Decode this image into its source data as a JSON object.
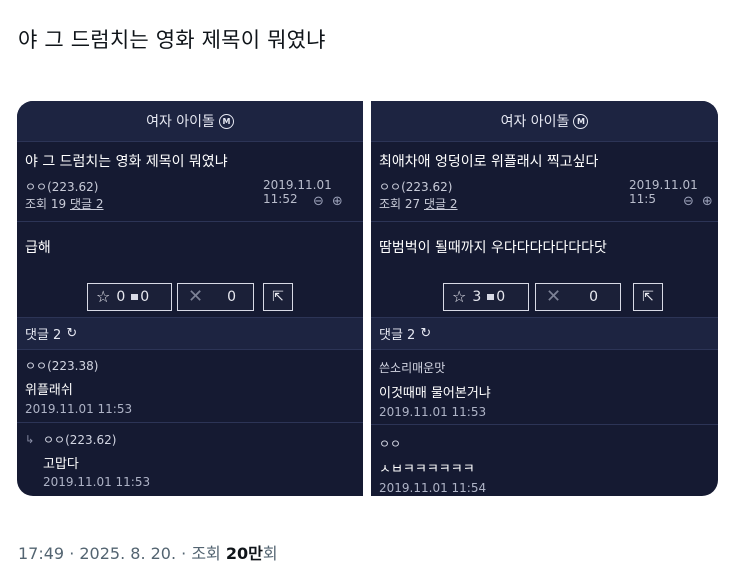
{
  "tweet": {
    "text": "야 그 드럼치는 영화 제목이 뭐였냐"
  },
  "left": {
    "header": "여자 아이돌",
    "header_badge": "M",
    "title": "야 그 드럼치는 영화 제목이 뭐였냐",
    "author": "ㅇㅇ(223.62)",
    "date": "2019.11.01 11:52",
    "views_label": "조회 19",
    "comments_link": "댓글 2",
    "body": "급해",
    "up_count": "0",
    "up_mini": "0",
    "down_count": "0",
    "comment_bar": "댓글 2",
    "comments": [
      {
        "author": "ㅇㅇ(223.38)",
        "text": "위플래쉬",
        "date": "2019.11.01 11:53"
      },
      {
        "author": "ㅇㅇ(223.62)",
        "text": "고맙다",
        "date": "2019.11.01 11:53"
      }
    ]
  },
  "right": {
    "header": "여자 아이돌",
    "header_badge": "M",
    "title": "최애차애 엉덩이로 위플래시 찍고싶다",
    "author": "ㅇㅇ(223.62)",
    "date": "2019.11.01 11:5",
    "views_label": "조회 27",
    "comments_link": "댓글 2",
    "body": "땀범벅이 될때까지 우다다다다다다다닷",
    "up_count": "3",
    "up_mini": "0",
    "down_count": "0",
    "comment_bar": "댓글 2",
    "comments": [
      {
        "author": "쓴소리매운맛",
        "text": "이것때매 물어본거냐",
        "date": "2019.11.01 11:53"
      },
      {
        "author": "ㅇㅇ",
        "text": "ㅅㅂㅋㅋㅋㅋㅋㅋ",
        "date": "2019.11.01 11:54"
      }
    ]
  },
  "footer": {
    "time": "17:49 · 2025. 8. 20. · 조회 ",
    "views": "20만",
    "suffix": "회"
  }
}
